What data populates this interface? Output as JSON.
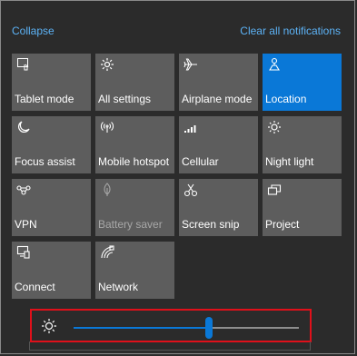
{
  "header": {
    "collapse_label": "Collapse",
    "clear_label": "Clear all notifications"
  },
  "tiles": [
    {
      "label": "Tablet mode",
      "icon": "tablet-icon",
      "state": "off"
    },
    {
      "label": "All settings",
      "icon": "gear-icon",
      "state": "off"
    },
    {
      "label": "Airplane mode",
      "icon": "airplane-icon",
      "state": "off"
    },
    {
      "label": "Location",
      "icon": "location-icon",
      "state": "on"
    },
    {
      "label": "Focus assist",
      "icon": "moon-icon",
      "state": "off"
    },
    {
      "label": "Mobile hotspot",
      "icon": "hotspot-icon",
      "state": "off"
    },
    {
      "label": "Cellular",
      "icon": "signal-icon",
      "state": "off"
    },
    {
      "label": "Night light",
      "icon": "sun-icon",
      "state": "off"
    },
    {
      "label": "VPN",
      "icon": "vpn-icon",
      "state": "off"
    },
    {
      "label": "Battery saver",
      "icon": "leaf-icon",
      "state": "disabled"
    },
    {
      "label": "Screen snip",
      "icon": "scissors-icon",
      "state": "off"
    },
    {
      "label": "Project",
      "icon": "project-icon",
      "state": "off"
    },
    {
      "label": "Connect",
      "icon": "connect-icon",
      "state": "off"
    },
    {
      "label": "Network",
      "icon": "network-icon",
      "state": "off"
    }
  ],
  "brightness": {
    "icon": "brightness-icon",
    "level_fraction": 0.6
  },
  "colors": {
    "accent": "#0a78d7",
    "link": "#5cb2f5",
    "tile": "#5d5d5d",
    "highlight_border": "#e0101a"
  }
}
